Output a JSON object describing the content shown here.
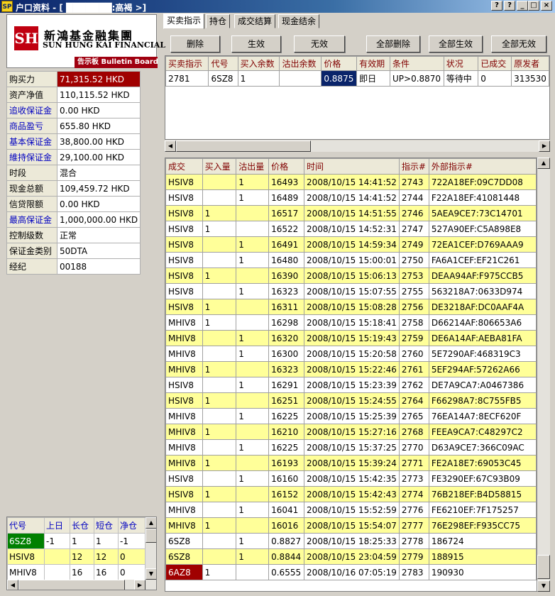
{
  "window": {
    "title": "户口资料 - [ ███████:高褐 >]",
    "app_icon": "SP",
    "buttons": [
      "?",
      "?",
      "_",
      "□",
      "×"
    ]
  },
  "logo": {
    "emblem": "SH",
    "cname": "新鴻基金融集團",
    "ename": "SUN HUNG KAI FINANCIAL",
    "bulletin": "告示板 Bulletin Board"
  },
  "account": [
    {
      "label": "购买力",
      "value": "71,315.52 HKD",
      "hl": true
    },
    {
      "label": "资产净值",
      "value": "110,115.52 HKD"
    },
    {
      "label": "追收保证金",
      "value": "0.00 HKD",
      "blue": true
    },
    {
      "label": "商品盈亏",
      "value": "655.80 HKD",
      "blue": true
    },
    {
      "label": "基本保证金",
      "value": "38,800.00 HKD",
      "blue": true
    },
    {
      "label": "維持保证金",
      "value": "29,100.00 HKD",
      "blue": true
    },
    {
      "label": "时段",
      "value": "混合"
    },
    {
      "label": "现金总额",
      "value": "109,459.72 HKD"
    },
    {
      "label": "信贷限额",
      "value": "0.00 HKD"
    },
    {
      "label": "最高保证金",
      "value": "1,000,000.00 HKD",
      "blue": true
    },
    {
      "label": "控制级数",
      "value": "正常"
    },
    {
      "label": "保证金类别",
      "value": "50DTA"
    },
    {
      "label": "经纪",
      "value": "00188"
    }
  ],
  "positions": {
    "headers": [
      "代号",
      "上日",
      "长仓",
      "短仓",
      "净仓"
    ],
    "rows": [
      {
        "c": [
          "6SZ8",
          "-1",
          "1",
          "1",
          "-1"
        ],
        "style": "g"
      },
      {
        "c": [
          "HSIV8",
          "",
          "12",
          "12",
          "0"
        ],
        "style": "y"
      },
      {
        "c": [
          "MHIV8",
          "",
          "16",
          "16",
          "0"
        ],
        "style": ""
      }
    ]
  },
  "tabs": [
    "买卖指示",
    "持仓",
    "成交结算",
    "现金结余"
  ],
  "actions": [
    "删除",
    "生效",
    "无效",
    "全部删除",
    "全部生效",
    "全部无效"
  ],
  "orders": {
    "headers": [
      "买卖指示",
      "代号",
      "买入余数",
      "沽出余数",
      "价格",
      "有效期",
      "条件",
      "状况",
      "已成交",
      "原发者"
    ],
    "rows": [
      [
        "2781",
        "6SZ8",
        "1",
        "",
        "0.8875",
        "即日",
        "UP>0.8870",
        "等待中",
        "0",
        "313530"
      ]
    ]
  },
  "trades": {
    "headers": [
      "成交",
      "买入量",
      "沽出量",
      "价格",
      "时间",
      "指示#",
      "外部指示#"
    ],
    "rows": [
      [
        "HSIV8",
        "",
        "1",
        "16493",
        "2008/10/15 14:41:52",
        "2743",
        "722A18EF:09C7DD08"
      ],
      [
        "HSIV8",
        "",
        "1",
        "16489",
        "2008/10/15 14:41:52",
        "2744",
        "F22A18EF:41081448"
      ],
      [
        "HSIV8",
        "1",
        "",
        "16517",
        "2008/10/15 14:51:55",
        "2746",
        "5AEA9CE7:73C14701"
      ],
      [
        "HSIV8",
        "1",
        "",
        "16522",
        "2008/10/15 14:52:31",
        "2747",
        "527A90EF:C5A898E8"
      ],
      [
        "HSIV8",
        "",
        "1",
        "16491",
        "2008/10/15 14:59:34",
        "2749",
        "72EA1CEF:D769AAA9"
      ],
      [
        "HSIV8",
        "",
        "1",
        "16480",
        "2008/10/15 15:00:01",
        "2750",
        "FA6A1CEF:EF21C261"
      ],
      [
        "HSIV8",
        "1",
        "",
        "16390",
        "2008/10/15 15:06:13",
        "2753",
        "DEAA94AF:F975CCB5"
      ],
      [
        "HSIV8",
        "",
        "1",
        "16323",
        "2008/10/15 15:07:55",
        "2755",
        "563218A7:0633D974"
      ],
      [
        "HSIV8",
        "1",
        "",
        "16311",
        "2008/10/15 15:08:28",
        "2756",
        "DE3218AF:DC0AAF4A"
      ],
      [
        "MHIV8",
        "1",
        "",
        "16298",
        "2008/10/15 15:18:41",
        "2758",
        "D66214AF:806653A6"
      ],
      [
        "MHIV8",
        "",
        "1",
        "16320",
        "2008/10/15 15:19:43",
        "2759",
        "DE6A14AF:AEBA81FA"
      ],
      [
        "MHIV8",
        "",
        "1",
        "16300",
        "2008/10/15 15:20:58",
        "2760",
        "5E7290AF:468319C3"
      ],
      [
        "MHIV8",
        "1",
        "",
        "16323",
        "2008/10/15 15:22:46",
        "2761",
        "5EF294AF:57262A66"
      ],
      [
        "HSIV8",
        "",
        "1",
        "16291",
        "2008/10/15 15:23:39",
        "2762",
        "DE7A9CA7:A0467386"
      ],
      [
        "HSIV8",
        "1",
        "",
        "16251",
        "2008/10/15 15:24:55",
        "2764",
        "F66298A7:8C755FB5"
      ],
      [
        "MHIV8",
        "",
        "1",
        "16225",
        "2008/10/15 15:25:39",
        "2765",
        "76EA14A7:8ECF620F"
      ],
      [
        "MHIV8",
        "1",
        "",
        "16210",
        "2008/10/15 15:27:16",
        "2768",
        "FEEA9CA7:C48297C2"
      ],
      [
        "MHIV8",
        "",
        "1",
        "16225",
        "2008/10/15 15:37:25",
        "2770",
        "D63A9CE7:366C09AC"
      ],
      [
        "MHIV8",
        "1",
        "",
        "16193",
        "2008/10/15 15:39:24",
        "2771",
        "FE2A18E7:69053C45"
      ],
      [
        "HSIV8",
        "",
        "1",
        "16160",
        "2008/10/15 15:42:35",
        "2773",
        "FE3290EF:67C93B09"
      ],
      [
        "HSIV8",
        "1",
        "",
        "16152",
        "2008/10/15 15:42:43",
        "2774",
        "76B218EF:B4D58815"
      ],
      [
        "MHIV8",
        "",
        "1",
        "16041",
        "2008/10/15 15:52:59",
        "2776",
        "FE6210EF:7F175257"
      ],
      [
        "MHIV8",
        "1",
        "",
        "16016",
        "2008/10/15 15:54:07",
        "2777",
        "76E298EF:F935CC75"
      ],
      [
        "6SZ8",
        "",
        "1",
        "0.8827",
        "2008/10/15 18:25:33",
        "2778",
        "186724"
      ],
      [
        "6SZ8",
        "",
        "1",
        "0.8844",
        "2008/10/15 23:04:59",
        "2779",
        "188915"
      ],
      [
        "6AZ8",
        "1",
        "",
        "0.6555",
        "2008/10/16 07:05:19",
        "2783",
        "190930"
      ]
    ]
  },
  "colors": {
    "highlight_row": "#ffff99",
    "header_text": "#800000",
    "label_blue": "#0000c0",
    "alert_red": "#a00000",
    "position_green": "#008000"
  },
  "icons": {
    "scroll_up": "▲",
    "scroll_down": "▼",
    "scroll_left": "◀",
    "scroll_right": "▶"
  }
}
